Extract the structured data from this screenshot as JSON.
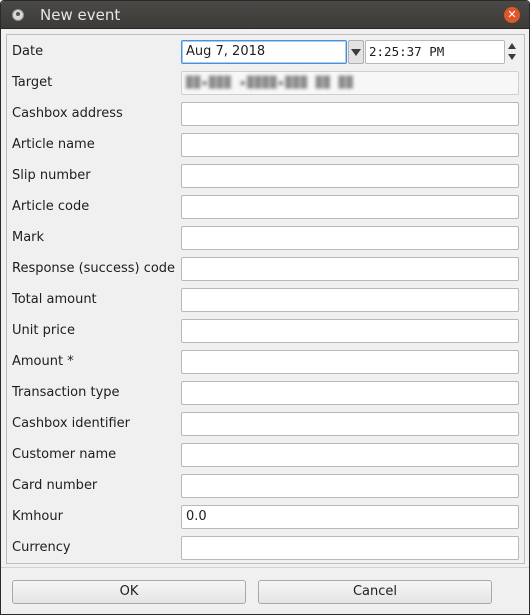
{
  "window": {
    "title": "New event",
    "close_symbol": "✕"
  },
  "form": {
    "date": {
      "label": "Date",
      "date_value": "Aug 7, 2018",
      "time_value": "2:25:37 PM"
    },
    "target": {
      "label": "Target",
      "value": "██▪███ ▪████▪███ ██ ██"
    },
    "fields": [
      {
        "label": "Cashbox address",
        "value": ""
      },
      {
        "label": "Article name",
        "value": ""
      },
      {
        "label": "Slip number",
        "value": ""
      },
      {
        "label": "Article code",
        "value": ""
      },
      {
        "label": "Mark",
        "value": ""
      },
      {
        "label": "Response (success) code",
        "value": ""
      },
      {
        "label": "Total amount",
        "value": ""
      },
      {
        "label": "Unit price",
        "value": ""
      },
      {
        "label": "Amount *",
        "value": ""
      },
      {
        "label": "Transaction type",
        "value": ""
      },
      {
        "label": "Cashbox identifier",
        "value": ""
      },
      {
        "label": "Customer name",
        "value": ""
      },
      {
        "label": "Card number",
        "value": ""
      },
      {
        "label": "Kmhour",
        "value": "0.0"
      },
      {
        "label": "Currency",
        "value": ""
      }
    ]
  },
  "buttons": {
    "ok_label": "OK",
    "cancel_label": "Cancel"
  }
}
